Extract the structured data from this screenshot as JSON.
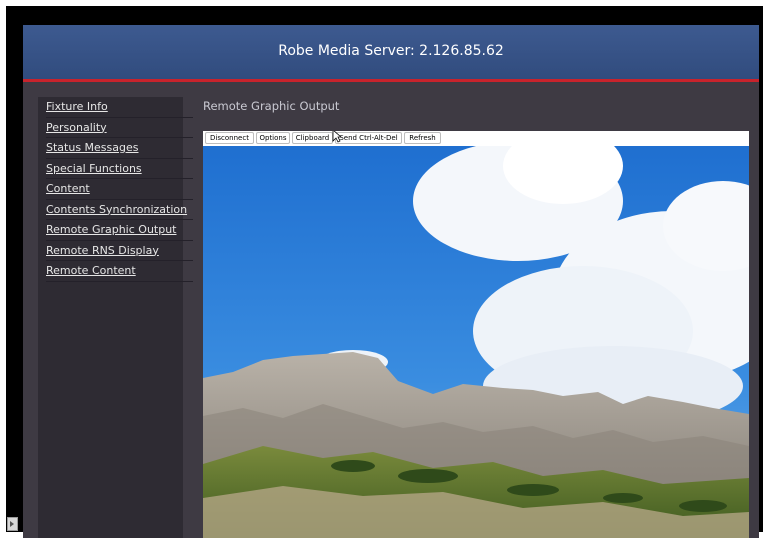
{
  "header": {
    "title": "Robe Media Server: 2.126.85.62"
  },
  "sidebar": {
    "items": [
      {
        "label": "Fixture Info"
      },
      {
        "label": "Personality"
      },
      {
        "label": "Status Messages"
      },
      {
        "label": "Special Functions"
      },
      {
        "label": "Content"
      },
      {
        "label": "Contents Synchronization"
      },
      {
        "label": "Remote Graphic Output"
      },
      {
        "label": "Remote RNS Display"
      },
      {
        "label": "Remote Content"
      }
    ]
  },
  "main": {
    "title": "Remote Graphic Output",
    "toolbar": {
      "disconnect": "Disconnect",
      "options": "Options",
      "clipboard": "Clipboard",
      "send_cad": "Send Ctrl-Alt-Del",
      "refresh": "Refresh"
    }
  },
  "colors": {
    "header_bg": "#3d5a90",
    "header_rule": "#c8232c",
    "page_bg": "#3e3a43",
    "sidebar_bg": "#2e2b33",
    "sky": "#2f7fd6"
  },
  "icons": {
    "cursor": "mouse-pointer-icon",
    "scroll": "scroll-left-arrow-icon"
  }
}
